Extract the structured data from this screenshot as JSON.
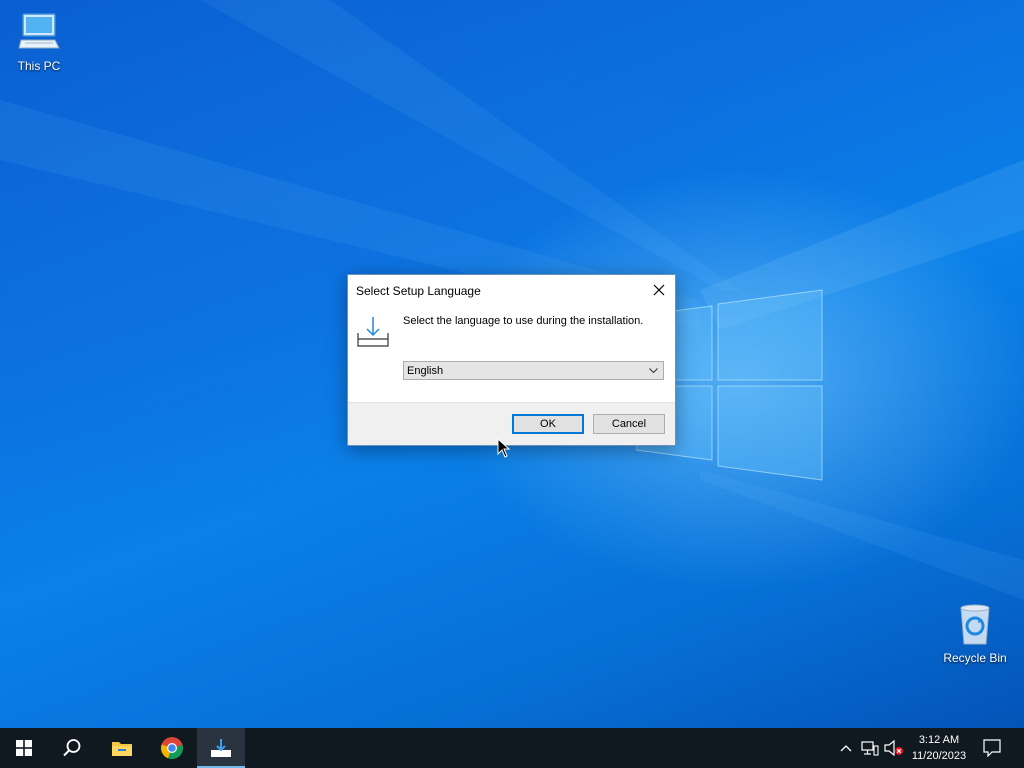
{
  "desktop": {
    "icons": [
      {
        "label": "This PC"
      },
      {
        "label": "Recycle Bin"
      }
    ]
  },
  "dialog": {
    "title": "Select Setup Language",
    "prompt": "Select the language to use during the installation.",
    "language_selected": "English",
    "ok_label": "OK",
    "cancel_label": "Cancel"
  },
  "taskbar": {
    "items": [
      "windows-start",
      "search",
      "file-explorer",
      "chrome",
      "setup"
    ],
    "clock": {
      "time": "3:12 AM",
      "date": "11/20/2023"
    }
  },
  "colors": {
    "accent": "#0078d7",
    "taskbar": "#101820"
  }
}
